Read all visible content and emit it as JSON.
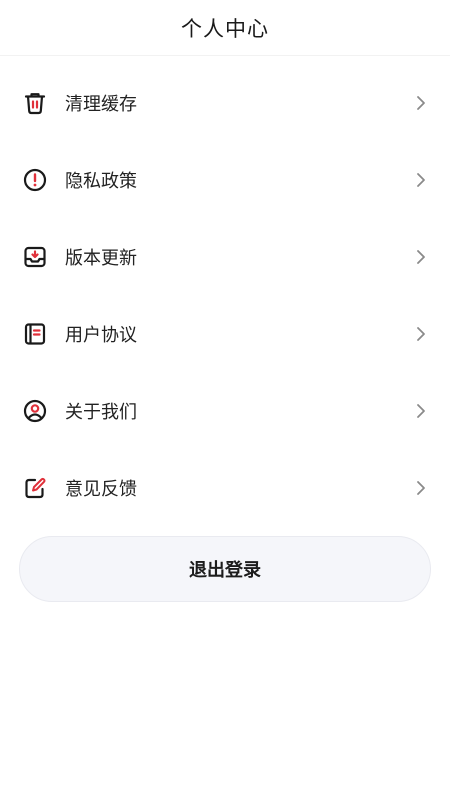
{
  "header": {
    "title": "个人中心"
  },
  "menu": {
    "items": [
      {
        "label": "清理缓存",
        "icon": "trash-icon"
      },
      {
        "label": "隐私政策",
        "icon": "alert-circle-icon"
      },
      {
        "label": "版本更新",
        "icon": "inbox-download-icon"
      },
      {
        "label": "用户协议",
        "icon": "document-icon"
      },
      {
        "label": "关于我们",
        "icon": "user-circle-icon"
      },
      {
        "label": "意见反馈",
        "icon": "edit-icon"
      }
    ]
  },
  "logout": {
    "label": "退出登录"
  },
  "colors": {
    "accent": "#e0303a",
    "icon_stroke": "#1a1a1a",
    "chevron": "#8a8a8a",
    "button_bg": "#f5f6fa"
  }
}
